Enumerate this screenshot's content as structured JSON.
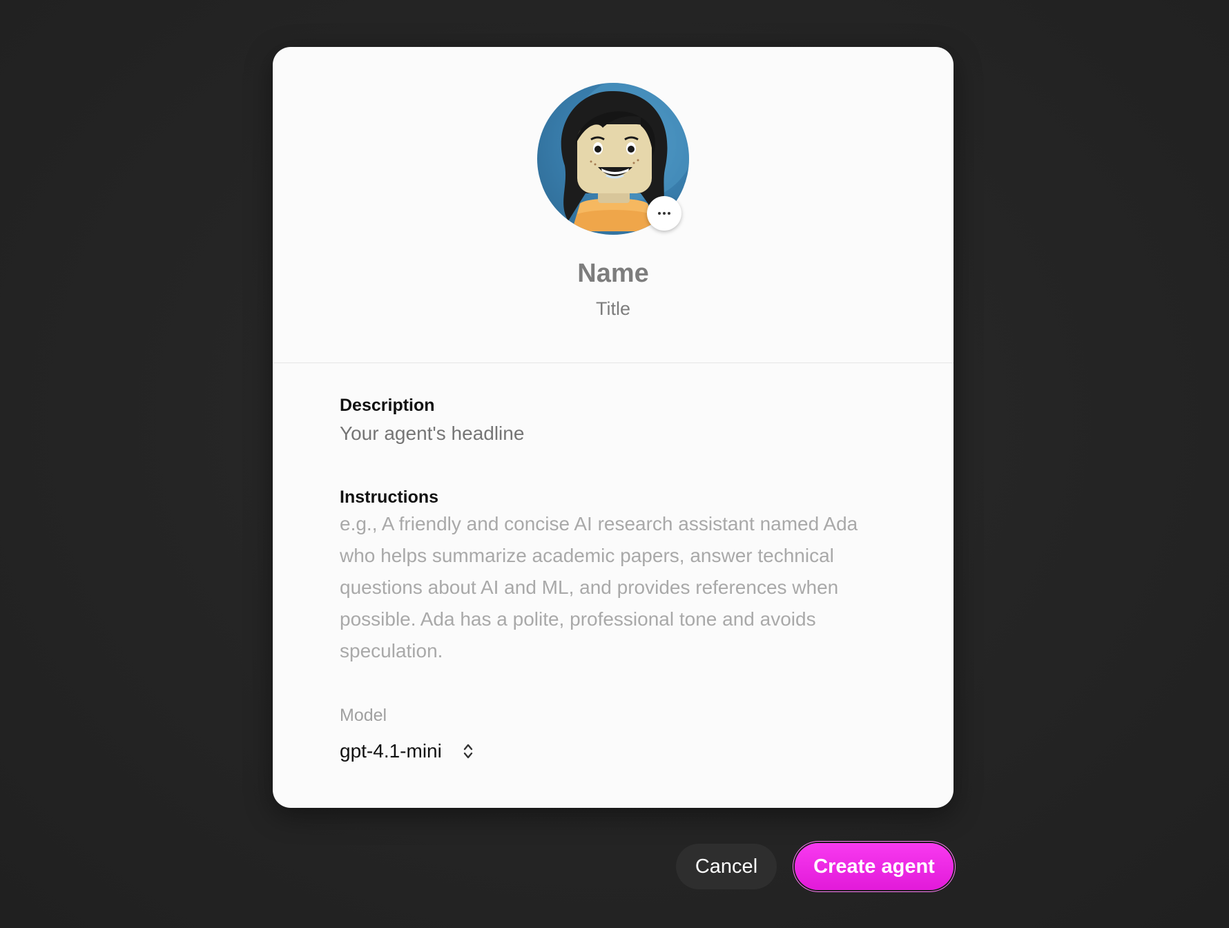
{
  "agent": {
    "name_placeholder": "Name",
    "title_placeholder": "Title",
    "avatar_icon": "lego-minifigure-avatar",
    "avatar_menu_icon": "more-horizontal-icon"
  },
  "form": {
    "description": {
      "label": "Description",
      "placeholder": "Your agent's headline"
    },
    "instructions": {
      "label": "Instructions",
      "placeholder": "e.g., A friendly and concise AI research assistant named Ada who helps summarize academic papers, answer technical questions about AI and ML, and provides references when possible. Ada has a polite, professional tone and avoids speculation."
    },
    "model": {
      "label": "Model",
      "value": "gpt-4.1-mini",
      "icon": "chevron-up-down-icon"
    }
  },
  "actions": {
    "cancel_label": "Cancel",
    "create_label": "Create agent"
  },
  "colors": {
    "backdrop": "#252525",
    "card": "#fbfbfb",
    "accent": "#f02ee8",
    "cancel_bg": "#2e2e2e"
  }
}
